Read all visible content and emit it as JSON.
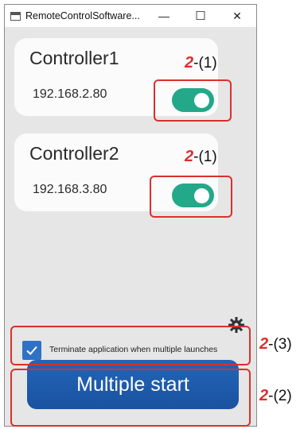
{
  "window": {
    "title": "RemoteControlSoftware...",
    "buttons": {
      "minimize": "—",
      "maximize": "☐",
      "close": "✕"
    }
  },
  "controllers": [
    {
      "name": "Controller1",
      "ip": "192.168.2.80",
      "enabled": true
    },
    {
      "name": "Controller2",
      "ip": "192.168.3.80",
      "enabled": true
    }
  ],
  "settings": {
    "icon": "gear-icon"
  },
  "terminate_option": {
    "checked": true,
    "label": "Terminate application when multiple launches"
  },
  "start_button": {
    "label": "Multiple start"
  },
  "annotations": {
    "toggle1": {
      "num": "2",
      "ref": "-(1)"
    },
    "toggle2": {
      "num": "2",
      "ref": "-(1)"
    },
    "checkbox": {
      "num": "2",
      "ref": "-(3)"
    },
    "start": {
      "num": "2",
      "ref": "-(2)"
    }
  },
  "colors": {
    "toggle_on": "#23a889",
    "accent_blue": "#2f72c4",
    "annotation_red": "#d9302e"
  }
}
